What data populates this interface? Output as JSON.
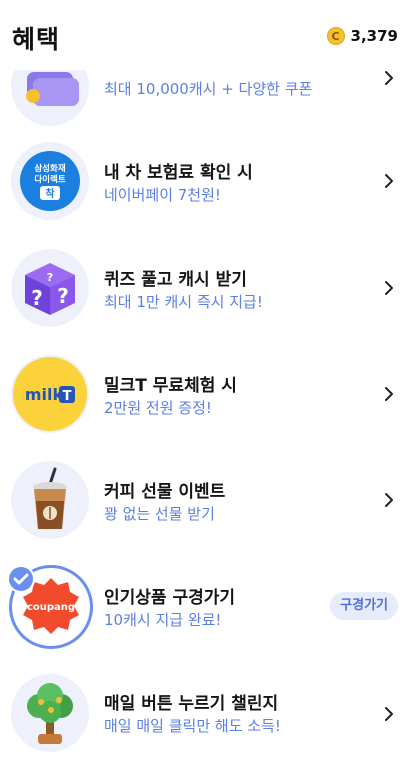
{
  "header": {
    "title": "혜택",
    "coin_symbol": "C",
    "points": "3,379"
  },
  "items": [
    {
      "title": "",
      "subtitle": "최대 10,000캐시 + 다양한 쿠폰",
      "icon": "gift-card-icon",
      "action": "chevron"
    },
    {
      "title": "내 차 보험료 확인 시",
      "subtitle": "네이버페이 7천원!",
      "icon": "samsung-insurance-icon",
      "icon_text_1": "삼성화재",
      "icon_text_2": "다이렉트",
      "icon_text_3": "착",
      "action": "chevron"
    },
    {
      "title": "퀴즈 풀고 캐시 받기",
      "subtitle": "최대 1만 캐시 즉시 지급!",
      "icon": "quiz-box-icon",
      "action": "chevron"
    },
    {
      "title": "밀크T 무료체험 시",
      "subtitle": "2만원 전원 증정!",
      "icon": "milkt-logo-icon",
      "icon_text_1": "milk",
      "icon_text_2": "T",
      "action": "chevron"
    },
    {
      "title": "커피 선물 이벤트",
      "subtitle": "꽝 없는 선물 받기",
      "icon": "iced-coffee-icon",
      "action": "chevron"
    },
    {
      "title": "인기상품 구경가기",
      "subtitle": "10캐시 지급 완료!",
      "icon": "coupang-badge-icon",
      "icon_text_1": "coupang",
      "action": "button",
      "button_label": "구경가기",
      "completed": true
    },
    {
      "title": "매일 버튼 누르기 챌린지",
      "subtitle": "매일 매일 클릭만 해도 소득!",
      "icon": "money-tree-icon",
      "action": "chevron"
    }
  ],
  "colors": {
    "accent": "#5b7fe6",
    "icon_bg": "#eef1fc",
    "coin": "#f5c02f"
  }
}
